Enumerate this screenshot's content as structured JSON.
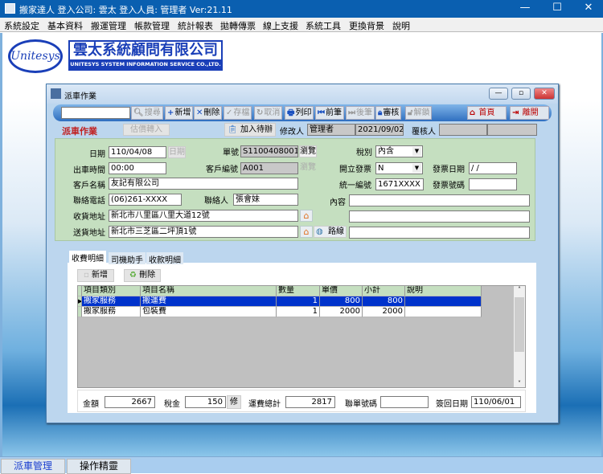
{
  "window": {
    "title": "搬家達人  登入公司: 雲太  登入人員: 管理者 Ver:21.11",
    "minimize": "—",
    "maximize": "☐",
    "close": "✕"
  },
  "menu": [
    "系統設定",
    "基本資料",
    "搬運管理",
    "帳款管理",
    "統計報表",
    "拋轉傳票",
    "線上支援",
    "系統工具",
    "更換背景",
    "說明"
  ],
  "logo": {
    "oval": "Unitesys",
    "company_cn": "雲太系統顧問有限公司",
    "company_en": "UNITESYS SYSTEM INFORMATION SERVICE CO.,LTD."
  },
  "dialog": {
    "title": "派車作業",
    "toolbar": {
      "search_value": "",
      "search": "搜尋",
      "add": "新增",
      "delete": "刪除",
      "save": "存檔",
      "cancel": "取消",
      "print": "列印",
      "prev": "前筆",
      "next": "後筆",
      "audit": "審核",
      "unlock": "解鎖",
      "home": "首頁",
      "exit": "離開"
    },
    "header": {
      "heading": "派車作業",
      "quote_import": "估價轉入",
      "add_todo": "加入待辦",
      "modifier_label": "修改人",
      "modifier": "管理者",
      "modified_date": "2021/09/02",
      "reviewer_label": "覆核人",
      "reviewer": "",
      "reviewer2": ""
    },
    "form": {
      "date_label": "日期",
      "date": "110/04/08",
      "date_btn": "日期",
      "order_no_label": "單號",
      "order_no": "S1100408001",
      "browse": "瀏覽",
      "tax_type_label": "稅別",
      "tax_type": "內含",
      "depart_time_label": "出車時間",
      "depart_time": "00:00",
      "customer_code_label": "客戶編號",
      "customer_code": "A001",
      "browse2": "瀏覽",
      "invoice_label": "開立發票",
      "invoice": "N",
      "invoice_date_label": "發票日期",
      "invoice_date": " / /",
      "customer_name_label": "客戶名稱",
      "customer_name": "友記有限公司",
      "tax_id_label": "統一編號",
      "tax_id": "1671XXXX",
      "invoice_no_label": "發票號碼",
      "invoice_no": "",
      "phone_label": "聯絡電話",
      "phone": "(06)261-XXXX",
      "contact_label": "聯絡人",
      "contact": "張會妹",
      "content_label": "內容",
      "content1": "",
      "content2": "",
      "content3": "",
      "pickup_label": "收貨地址",
      "pickup": "新北市八里區八里大道12號",
      "delivery_label": "送貨地址",
      "delivery": "新北市三芝區二坪頂1號",
      "route": "路線"
    },
    "tabs": [
      "收費明細",
      "司機助手",
      "收款明細"
    ],
    "grid_buttons": {
      "add": "新增",
      "delete": "刪除"
    },
    "grid": {
      "columns": [
        "項目類別",
        "項目名稱",
        "數量",
        "單價",
        "小計",
        "說明"
      ],
      "rows": [
        [
          "搬家服務",
          "搬運費",
          "1",
          "800",
          "800",
          ""
        ],
        [
          "搬家服務",
          "包裝費",
          "1",
          "2000",
          "2000",
          ""
        ]
      ]
    },
    "totals": {
      "amount_label": "金額",
      "amount": "2667",
      "tax_label": "稅金",
      "tax": "150",
      "tax_edit": "修",
      "freight_label": "運費總計",
      "freight": "2817",
      "joint_no_label": "聯單號碼",
      "joint_no": "",
      "return_date_label": "簽回日期",
      "return_date": "110/06/01"
    }
  },
  "status_tabs": [
    "派車管理",
    "操作精靈"
  ],
  "colors": {
    "accent": "#0a5fb0",
    "form_bg": "#c5dfc0",
    "selected_row": "#0033cc"
  }
}
